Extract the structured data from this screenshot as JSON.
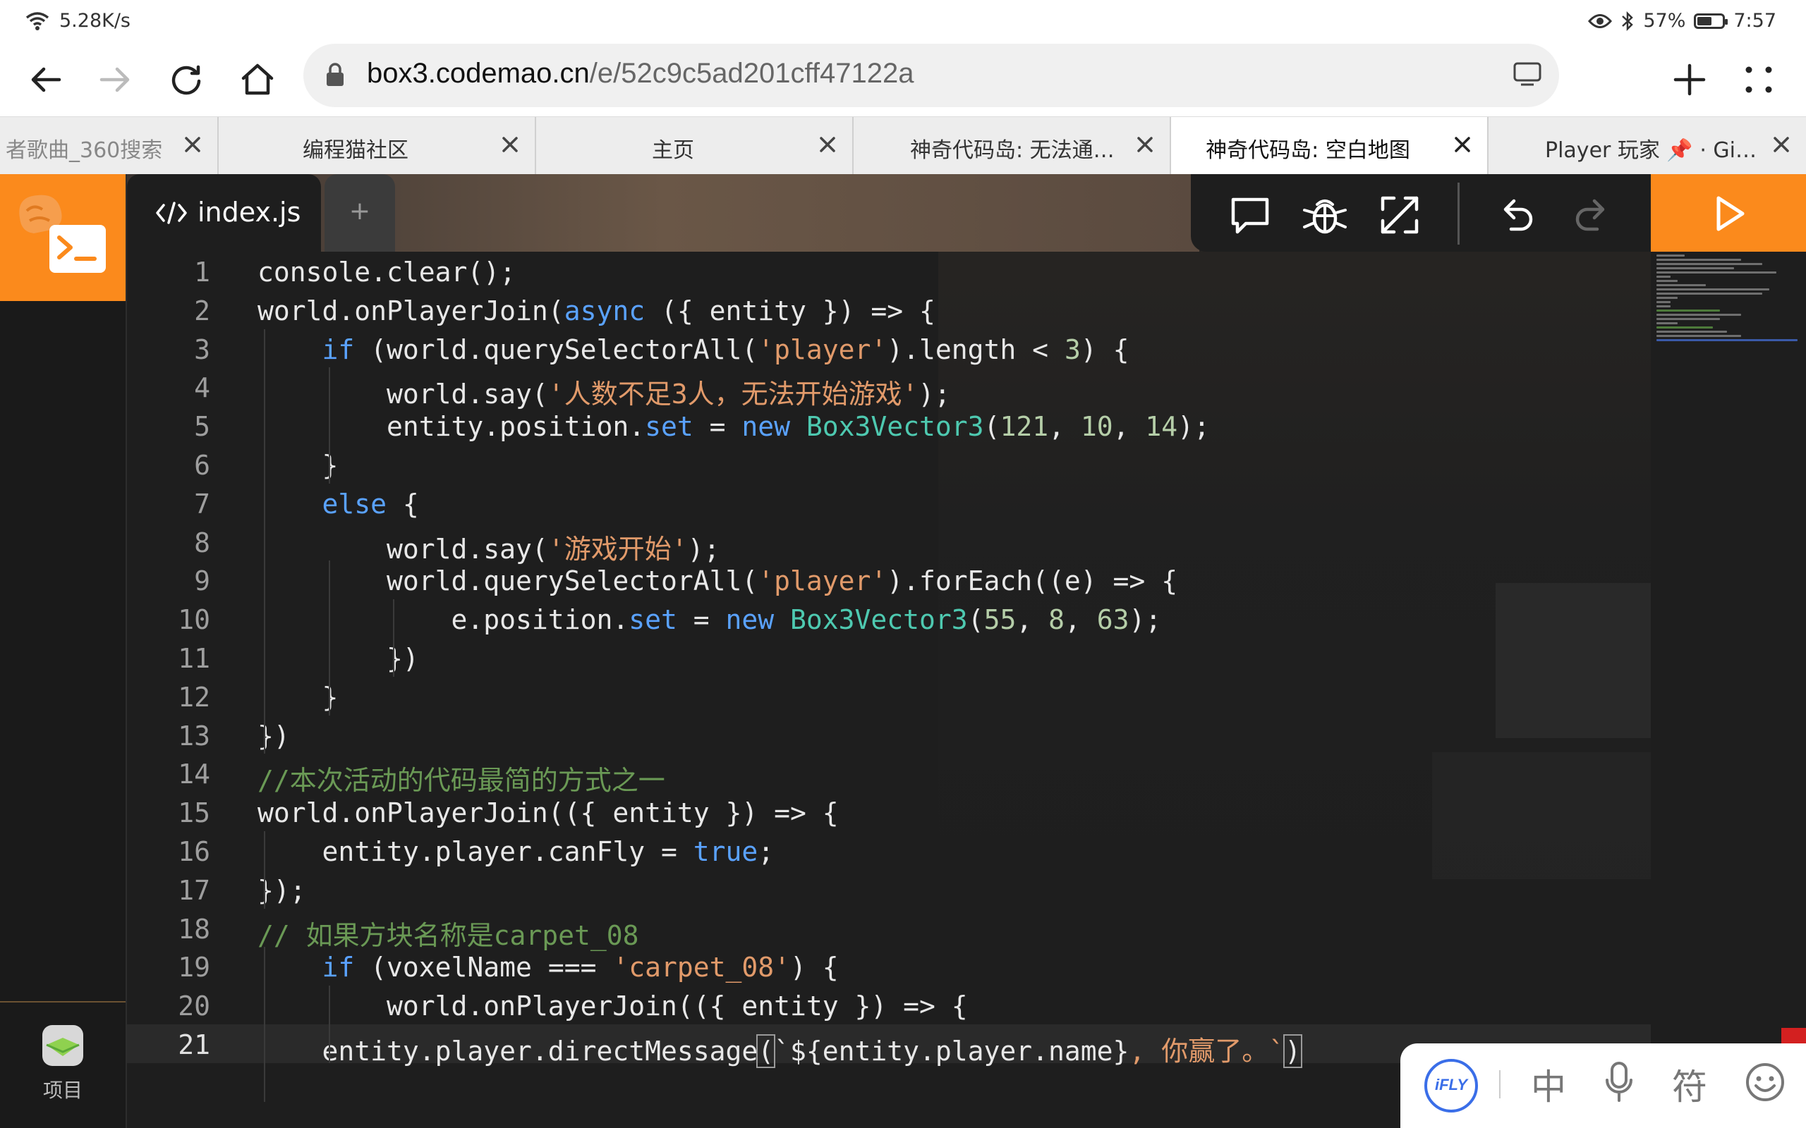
{
  "status_bar": {
    "network_speed": "5.28K/s",
    "battery_percent": "57%",
    "battery_level": 0.57,
    "time": "7:57"
  },
  "address_bar": {
    "host": "box3.codemao.cn",
    "path": "/e/52c9c5ad201cff47122a"
  },
  "tabs": [
    {
      "label": "者歌曲_360搜索"
    },
    {
      "label": "编程猫社区"
    },
    {
      "label": "主页"
    },
    {
      "label": "神奇代码岛: 无法通过审核"
    },
    {
      "label": "神奇代码岛: 空白地图"
    },
    {
      "label": "Player 玩家 📌 · GitBook"
    }
  ],
  "active_tab_index": 4,
  "editor": {
    "file_tab_label": "index.js",
    "add_tab_label": "+",
    "sidebar_label": "项目",
    "lines": [
      {
        "n": "1",
        "p": "console.clear();"
      },
      {
        "n": "2",
        "p": "world.onPlayerJoin(",
        "k": "async",
        "q": " ({ entity }) => {"
      },
      {
        "n": "3",
        "a": "    ",
        "k": "if",
        "p": " (world.querySelectorAll(",
        "s": "'player'",
        "q": ").length < ",
        "m": "3",
        "r": ") {"
      },
      {
        "n": "4",
        "a": "        ",
        "p": "world.say(",
        "s": "'人数不足3人，无法开始游戏'",
        "q": ");"
      },
      {
        "n": "5",
        "a": "        ",
        "p": "entity.position.",
        "k": "set",
        "q": " = ",
        "k2": "new",
        "t": " Box3Vector3",
        "r": "(",
        "m": "121",
        "r2": ", ",
        "m2": "10",
        "r3": ", ",
        "m3": "14",
        "r4": ");"
      },
      {
        "n": "6",
        "a": "    ",
        "p": "}"
      },
      {
        "n": "7",
        "a": "    ",
        "k": "else",
        "p": " {"
      },
      {
        "n": "8",
        "a": "        ",
        "p": "world.say(",
        "s": "'游戏开始'",
        "q": ");"
      },
      {
        "n": "9",
        "a": "        ",
        "p": "world.querySelectorAll(",
        "s": "'player'",
        "q": ").forEach((e) => {"
      },
      {
        "n": "10",
        "a": "            ",
        "p": "e.position.",
        "k": "set",
        "q": " = ",
        "k2": "new",
        "t": " Box3Vector3",
        "r": "(",
        "m": "55",
        "r2": ", ",
        "m2": "8",
        "r3": ", ",
        "m3": "63",
        "r4": ");"
      },
      {
        "n": "11",
        "a": "        ",
        "p": "})"
      },
      {
        "n": "12",
        "a": "    ",
        "p": "}"
      },
      {
        "n": "13",
        "p": "})"
      },
      {
        "n": "14",
        "c": "//本次活动的代码最简的方式之一"
      },
      {
        "n": "15",
        "p": "world.onPlayerJoin(({ entity }) => {"
      },
      {
        "n": "16",
        "a": "    ",
        "p": "entity.player.canFly = ",
        "k": "true",
        "q": ";"
      },
      {
        "n": "17",
        "p": "});"
      },
      {
        "n": "18",
        "c": "// 如果方块名称是carpet_08"
      },
      {
        "n": "19",
        "a": "    ",
        "k": "if",
        "p": " (voxelName === ",
        "s": "'carpet_08'",
        "q": ") {"
      },
      {
        "n": "20",
        "a": "        ",
        "p": "world.onPlayerJoin(({ entity }) => {"
      },
      {
        "n": "21",
        "a": "    ",
        "p": "entity.player.directMessage",
        "b1": "(",
        "q": "`${entity.player.name}",
        "s": ", 你赢了。`",
        "b2": ")"
      }
    ],
    "current_line": "21"
  },
  "ime": {
    "logo": "iFLY",
    "mode": "中",
    "symbol": "符"
  }
}
